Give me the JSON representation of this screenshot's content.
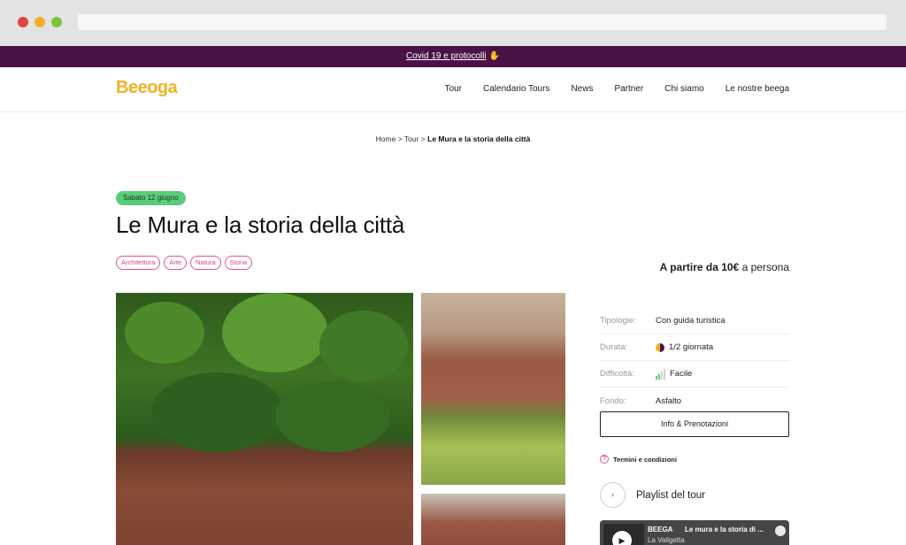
{
  "banner": {
    "text": "Covid 19 e protocolli"
  },
  "logo": {
    "text": "Beeoga"
  },
  "nav": {
    "items": [
      "Tour",
      "Calendario Tours",
      "News",
      "Partner",
      "Chi siamo",
      "Le nostre beega"
    ]
  },
  "breadcrumb": {
    "home": "Home",
    "sep1": ">",
    "section": "Tour",
    "sep2": ">",
    "current": "Le Mura e la storia della città"
  },
  "event": {
    "date": "Sabato 12 giugno",
    "title": "Le Mura e la storia della città",
    "tags": [
      "Architettura",
      "Arte",
      "Natura",
      "Storia"
    ],
    "price_prefix": "A partire da",
    "price_amount": "10€",
    "price_suffix": "a persona"
  },
  "details": {
    "tipologie_label": "Tipologie:",
    "tipologie_value": "Con guida turistica",
    "durata_label": "Durata:",
    "durata_value": "1/2 giornata",
    "difficolta_label": "Difficoltà:",
    "difficolta_value": "Facile",
    "fondo_label": "Fondo:",
    "fondo_value": "Asfalto"
  },
  "cta": {
    "label": "Info & Prenotazioni"
  },
  "terms": {
    "label": "Termini e condizioni"
  },
  "playlist": {
    "title": "Playlist del tour"
  },
  "spotify": {
    "artist": "BEEGA",
    "track": "Le mura e la storia di ...",
    "subtitle": "La Valigetta"
  },
  "colors": {
    "banner": "#4a1247",
    "brand": "#f0b323",
    "tag": "#e1577a",
    "date_pill": "#5ccc7a"
  }
}
